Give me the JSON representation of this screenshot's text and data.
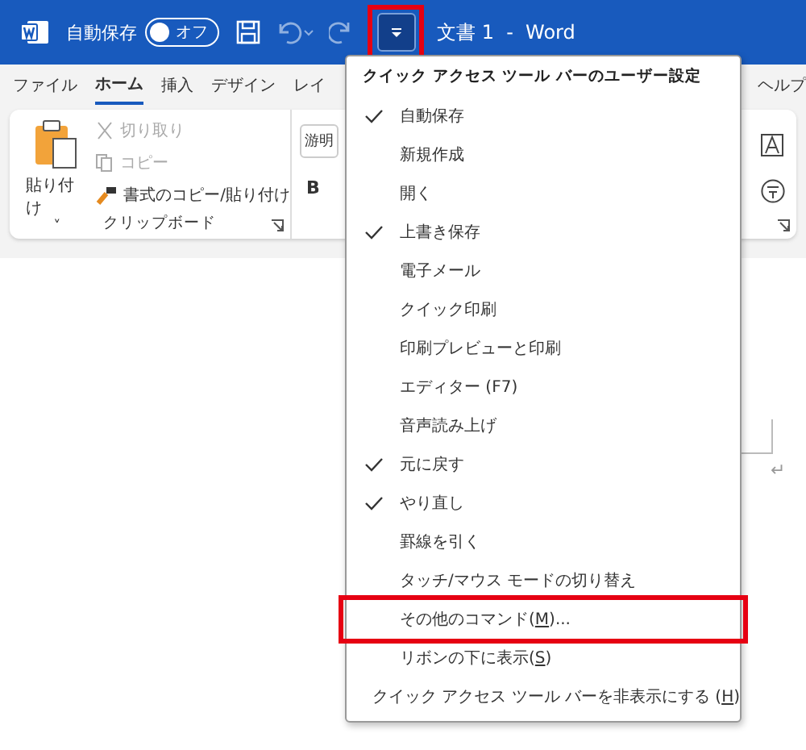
{
  "title_bar": {
    "autosave_label": "自動保存",
    "autosave_toggle": {
      "label": "オフ",
      "on": false
    },
    "qat_menu_button": {
      "highlighted": true
    },
    "document_title": "文書 1  -  Word"
  },
  "tabs": [
    {
      "label": "ファイル",
      "selected": false
    },
    {
      "label": "ホーム",
      "selected": true
    },
    {
      "label": "挿入",
      "selected": false
    },
    {
      "label": "デザイン",
      "selected": false
    },
    {
      "label": "レイ",
      "selected": false
    }
  ],
  "right_tab": {
    "label": "ヘルプ",
    "selected": false
  },
  "clipboard_group": {
    "paste": "貼り付け",
    "paste_caret": "˅",
    "cut": {
      "label": "切り取り",
      "disabled": true
    },
    "copy": {
      "label": "コピー",
      "disabled": true
    },
    "format_painter": {
      "label": "書式のコピー/貼り付け",
      "disabled": false
    },
    "group_label": "クリップボード"
  },
  "font_group": {
    "font_name": "游明",
    "bold": "B"
  },
  "menu": {
    "title": "クイック アクセス ツール バーのユーザー設定",
    "items": [
      {
        "kind": "toggle",
        "label": "自動保存",
        "checked": true,
        "highlighted": false
      },
      {
        "kind": "toggle",
        "label": "新規作成",
        "checked": false,
        "highlighted": false
      },
      {
        "kind": "toggle",
        "label": "開く",
        "checked": false,
        "highlighted": false
      },
      {
        "kind": "toggle",
        "label": "上書き保存",
        "checked": true,
        "highlighted": false
      },
      {
        "kind": "toggle",
        "label": "電子メール",
        "checked": false,
        "highlighted": false
      },
      {
        "kind": "toggle",
        "label": "クイック印刷",
        "checked": false,
        "highlighted": false
      },
      {
        "kind": "toggle",
        "label": "印刷プレビューと印刷",
        "checked": false,
        "highlighted": false
      },
      {
        "kind": "toggle",
        "label": "エディター (F7)",
        "checked": false,
        "highlighted": false
      },
      {
        "kind": "toggle",
        "label": "音声読み上げ",
        "checked": false,
        "highlighted": false
      },
      {
        "kind": "toggle",
        "label": "元に戻す",
        "checked": true,
        "highlighted": false
      },
      {
        "kind": "toggle",
        "label": "やり直し",
        "checked": true,
        "highlighted": false
      },
      {
        "kind": "toggle",
        "label": "罫線を引く",
        "checked": false,
        "highlighted": false
      },
      {
        "kind": "toggle",
        "label": "タッチ/マウス モードの切り替え",
        "checked": false,
        "highlighted": false
      },
      {
        "kind": "command",
        "label": "その他のコマンド(",
        "key": "M",
        "tail": ")...",
        "highlighted": true
      },
      {
        "kind": "command",
        "label": "リボンの下に表示(",
        "key": "S",
        "tail": ")",
        "highlighted": false
      },
      {
        "kind": "command",
        "label": "クイック アクセス ツール バーを非表示にする (",
        "key": "H",
        "tail": ")",
        "highlighted": false
      }
    ]
  },
  "document": {
    "paragraph_mark": "↵"
  }
}
